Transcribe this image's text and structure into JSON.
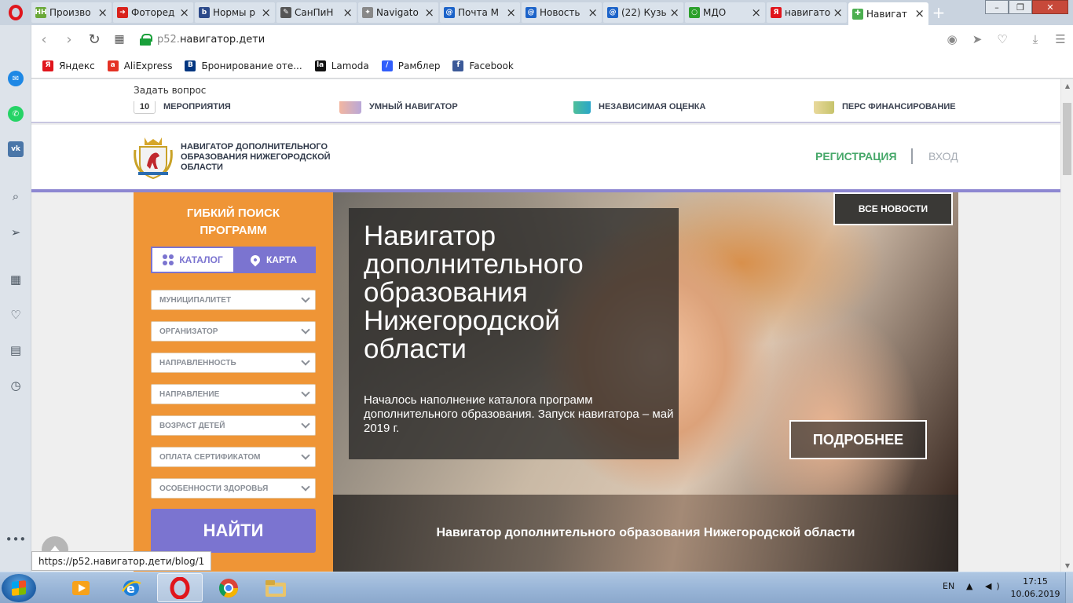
{
  "browser": {
    "tabs": [
      {
        "title": "Произво",
        "favicon_text": "HH",
        "favicon_color": "#6aa838"
      },
      {
        "title": "Фоторед",
        "favicon_text": "➔",
        "favicon_color": "#d9221c"
      },
      {
        "title": "Нормы р",
        "favicon_text": "b",
        "favicon_color": "#2c4a8a"
      },
      {
        "title": "СанПиН",
        "favicon_text": "✎",
        "favicon_color": "#555555"
      },
      {
        "title": "Navigato",
        "favicon_text": "✦",
        "favicon_color": "#888888"
      },
      {
        "title": "Почта М",
        "favicon_text": "@",
        "favicon_color": "#1c63c9"
      },
      {
        "title": "Новость",
        "favicon_text": "@",
        "favicon_color": "#1c63c9"
      },
      {
        "title": "(22) Кузь",
        "favicon_text": "@",
        "favicon_color": "#1c63c9"
      },
      {
        "title": "МДО",
        "favicon_text": "○",
        "favicon_color": "#2ca02c"
      },
      {
        "title": "навигато",
        "favicon_text": "Я",
        "favicon_color": "#e0151c"
      },
      {
        "title": "Навигат",
        "favicon_text": "✚",
        "favicon_color": "#4caf50",
        "active": true
      }
    ],
    "address": {
      "url_dim": "p52.",
      "url_main": "навигатор.дети"
    },
    "bookmarks": [
      {
        "label": "Яндекс",
        "favicon_text": "Я",
        "favicon_color": "#e0151c"
      },
      {
        "label": "AliExpress",
        "favicon_text": "a",
        "favicon_color": "#e43225"
      },
      {
        "label": "Бронирование оте...",
        "favicon_text": "B",
        "favicon_color": "#003580"
      },
      {
        "label": "Lamoda",
        "favicon_text": "la",
        "favicon_color": "#111111"
      },
      {
        "label": "Рамблер",
        "favicon_text": "/",
        "favicon_color": "#315efb"
      },
      {
        "label": "Facebook",
        "favicon_text": "f",
        "favicon_color": "#3b5998"
      }
    ],
    "status_url": "https://p52.навигатор.дети/blog/1"
  },
  "site": {
    "ask_link": "Задать вопрос",
    "quick_links": [
      {
        "label": "МЕРОПРИЯТИЯ",
        "icon": "calendar-icon",
        "badge": "10"
      },
      {
        "label": "УМНЫЙ НАВИГАТОР",
        "icon": "people-icon"
      },
      {
        "label": "НЕЗАВИСИМАЯ ОЦЕНКА",
        "icon": "chart-icon"
      },
      {
        "label": "ПЕРС ФИНАНСИРОВАНИЕ",
        "icon": "certificate-icon"
      }
    ],
    "name": "НАВИГАТОР ДОПОЛНИТЕЛЬНОГО ОБРАЗОВАНИЯ НИЖЕГОРОДСКОЙ ОБЛАСТИ",
    "register": "РЕГИСТРАЦИЯ",
    "login": "ВХОД",
    "colors": {
      "accent_green": "#47a86a",
      "accent_purple": "#7b74d0",
      "panel_orange": "#ef9536"
    }
  },
  "search": {
    "title": "ГИБКИЙ ПОИСК\nПРОГРАММ",
    "catalog": "КАТАЛОГ",
    "map": "КАРТА",
    "filters": [
      "МУНИЦИПАЛИТЕТ",
      "ОРГАНИЗАТОР",
      "НАПРАВЛЕННОСТЬ",
      "НАПРАВЛЕНИЕ",
      "ВОЗРАСТ ДЕТЕЙ",
      "ОПЛАТА СЕРТИФИКАТОМ",
      "ОСОБЕННОСТИ ЗДОРОВЬЯ"
    ],
    "find": "НАЙТИ"
  },
  "hero": {
    "all_news": "ВСЕ НОВОСТИ",
    "title": "Навигатор\nдополнительного\nобразования\nНижегородской\nобласти",
    "text": "Началось наполнение каталога программ дополнительного образования. Запуск навигатора – май 2019 г.",
    "more": "ПОДРОБНЕЕ",
    "second_title": "Навигатор дополнительного образования Нижегородской области"
  },
  "taskbar": {
    "lang": "EN",
    "time": "17:15",
    "date": "10.06.2019"
  }
}
